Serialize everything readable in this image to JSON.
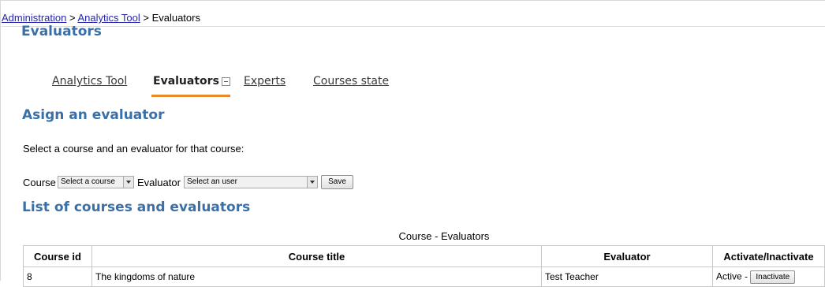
{
  "breadcrumb": {
    "item1": "Administration",
    "sep1": " > ",
    "item2": "Analytics Tool",
    "sep2": " > ",
    "item3": "Evaluators"
  },
  "page_title": "Evaluators",
  "tabs": [
    {
      "label": "Analytics Tool",
      "active": false
    },
    {
      "label": "Evaluators",
      "active": true,
      "icon": "collapse-icon"
    },
    {
      "label": "Experts",
      "active": false
    },
    {
      "label": "Courses state",
      "active": false
    }
  ],
  "assign": {
    "heading": "Asign an evaluator",
    "instruction": "Select a course and an evaluator for that course:",
    "course_label": "Course",
    "course_select": "Select a course",
    "evaluator_label": "Evaluator",
    "evaluator_select": "Select an user",
    "save_label": "Save"
  },
  "list": {
    "heading": "List of courses and evaluators",
    "caption": "Course - Evaluators",
    "columns": [
      "Course id",
      "Course title",
      "Evaluator",
      "Activate/Inactivate"
    ],
    "rows": [
      {
        "course_id": "8",
        "course_title": "The kingdoms of nature",
        "evaluator": "Test Teacher",
        "status": "Active -",
        "action": "Inactivate"
      }
    ]
  },
  "colors": {
    "link": "#2626a8",
    "heading": "#3b6fa7",
    "tab_accent": "#e8892e"
  }
}
